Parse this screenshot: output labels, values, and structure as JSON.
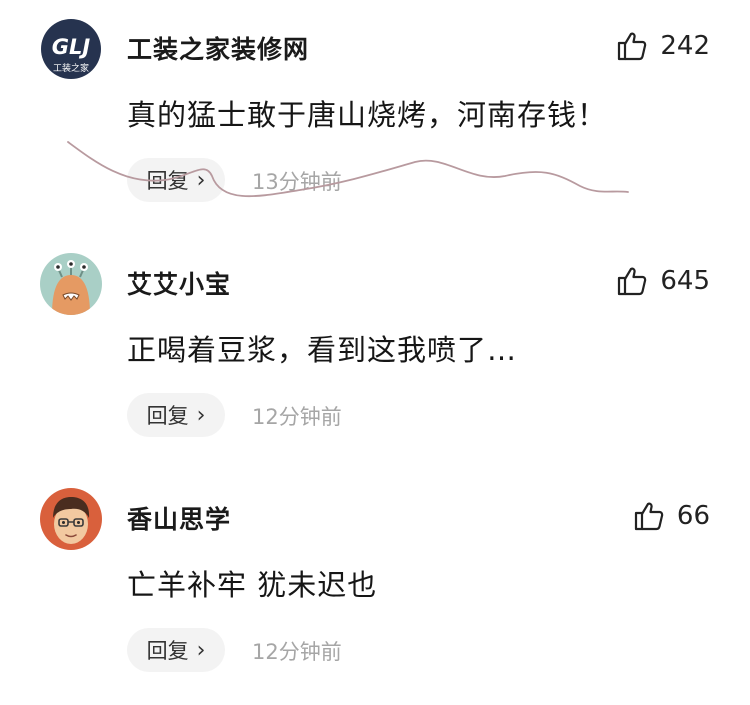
{
  "comments": [
    {
      "username": "工装之家装修网",
      "likes": "242",
      "text": "真的猛士敢于唐山烧烤，河南存钱！",
      "reply_label": "回复",
      "reply_chevron": "›",
      "time": "13分钟前",
      "avatar": {
        "type": "logo",
        "logo_text": "GLJ",
        "sub_text": "工装之家",
        "bg": "#2d3a5a"
      }
    },
    {
      "username": "艾艾小宝",
      "likes": "645",
      "text": "正喝着豆浆，看到这我喷了…",
      "reply_label": "回复",
      "reply_chevron": "›",
      "time": "12分钟前",
      "avatar": {
        "type": "alien-cartoon",
        "bg": "#a9cfc6"
      }
    },
    {
      "username": "香山思学",
      "likes": "66",
      "text": "亡羊补牢 犹未迟也",
      "reply_label": "回复",
      "reply_chevron": "›",
      "time": "12分钟前",
      "avatar": {
        "type": "cartoon-boy",
        "bg": "#d9603c"
      }
    }
  ],
  "icons": {
    "like": "thumbs-up-icon"
  },
  "colors": {
    "scribble": "#b89a9f",
    "time": "#a6a6a6",
    "reply_bg": "#f3f3f3"
  }
}
